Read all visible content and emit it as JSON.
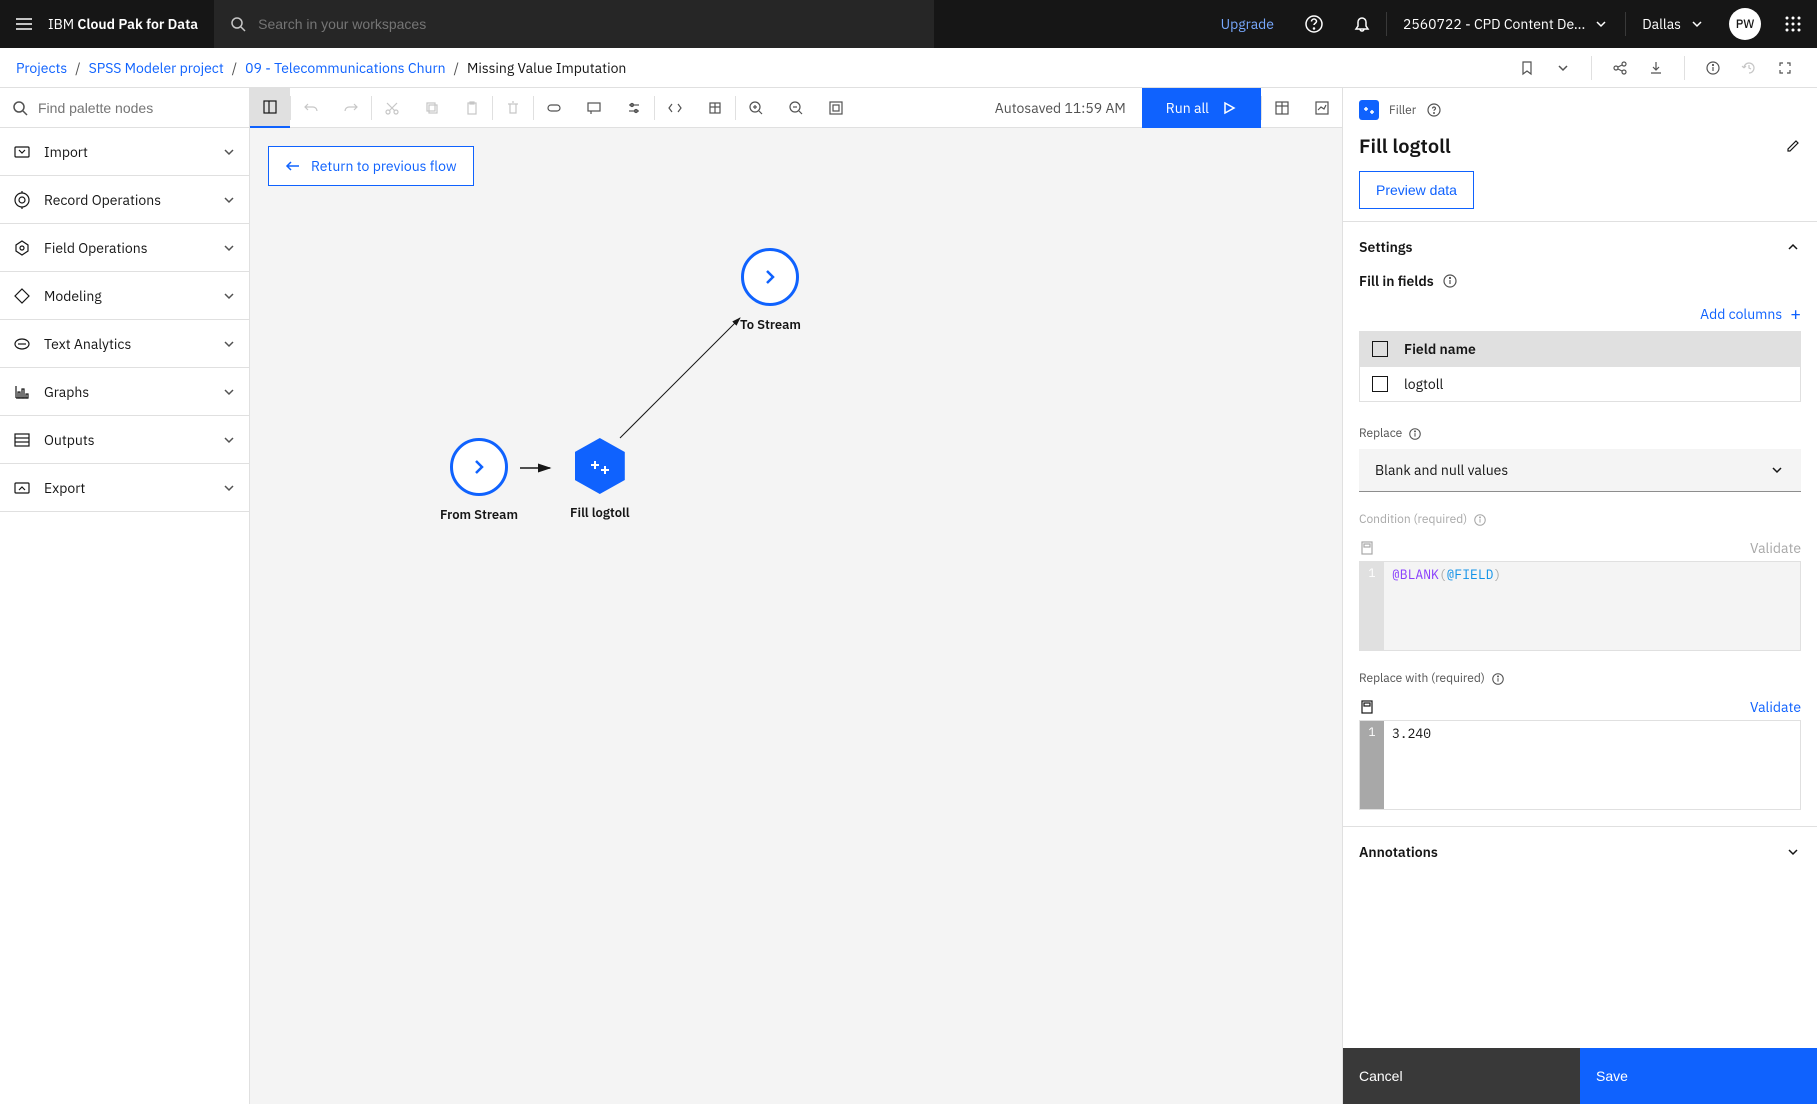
{
  "header": {
    "brand_prefix": "IBM ",
    "brand_bold": "Cloud Pak for Data",
    "search_placeholder": "Search in your workspaces",
    "upgrade": "Upgrade",
    "workspace": "2560722 - CPD Content De...",
    "region": "Dallas",
    "avatar": "PW"
  },
  "breadcrumb": {
    "items": [
      "Projects",
      "SPSS Modeler project",
      "09 - Telecommunications Churn",
      "Missing Value Imputation"
    ]
  },
  "palette": {
    "search_placeholder": "Find palette nodes",
    "items": [
      {
        "label": "Import"
      },
      {
        "label": "Record Operations"
      },
      {
        "label": "Field Operations"
      },
      {
        "label": "Modeling"
      },
      {
        "label": "Text Analytics"
      },
      {
        "label": "Graphs"
      },
      {
        "label": "Outputs"
      },
      {
        "label": "Export"
      }
    ]
  },
  "toolbar": {
    "autosave": "Autosaved 11:59 AM",
    "run": "Run all"
  },
  "canvas": {
    "return": "Return to previous flow",
    "nodes": {
      "from": "From Stream",
      "fill": "Fill logtoll",
      "to": "To Stream"
    }
  },
  "panel": {
    "type": "Filler",
    "title": "Fill logtoll",
    "preview": "Preview data",
    "settings_header": "Settings",
    "fill_fields_label": "Fill in fields",
    "add_columns": "Add columns",
    "field_header": "Field name",
    "field_value": "logtoll",
    "replace_label": "Replace",
    "replace_value": "Blank and null values",
    "condition_label": "Condition (required)",
    "validate": "Validate",
    "condition_code_fn": "@BLANK",
    "condition_code_var": "@FIELD",
    "replace_with_label": "Replace with (required)",
    "replace_with_code": "3.240",
    "annotations": "Annotations",
    "cancel": "Cancel",
    "save": "Save"
  }
}
